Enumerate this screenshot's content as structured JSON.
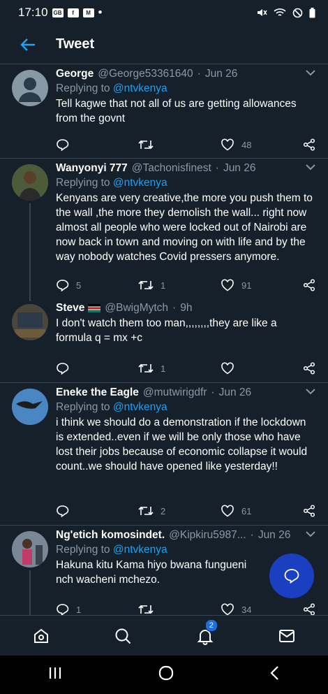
{
  "status_bar": {
    "time": "17:10",
    "notif_labels": [
      "GB",
      "f",
      "M"
    ]
  },
  "header": {
    "title": "Tweet"
  },
  "tweets": [
    {
      "name": "George",
      "handle": "@George53361640",
      "dot": "·",
      "time": "Jun 26",
      "replying_prefix": "Replying to ",
      "replying_to": "@ntvkenya",
      "text": "Tell kagwe that not all of us are getting allowances from the govnt",
      "replies": "",
      "retweets": "",
      "likes": "48"
    },
    {
      "name": "Wanyonyi 777",
      "handle": "@Tachonisfinest",
      "dot": "·",
      "time": "Jun 26",
      "replying_prefix": "Replying to ",
      "replying_to": "@ntvkenya",
      "text": "Kenyans are very creative,the more you push them to the wall ,the more they demolish the wall... right now almost all people who were locked out of Nairobi are now back in town and moving on with life and by the way nobody watches Covid pressers anymore.",
      "replies": "5",
      "retweets": "1",
      "likes": "91"
    },
    {
      "name": "Steve",
      "handle": "@BwigMytch",
      "dot": "·",
      "time": "9h",
      "text": "I don't watch them too man,,,,,,,,they are like a formula q = mx +c",
      "replies": "",
      "retweets": "1",
      "likes": ""
    },
    {
      "name": "Eneke the Eagle",
      "handle": "@mutwirigdfr",
      "dot": "·",
      "time": "Jun 26",
      "replying_prefix": "Replying to ",
      "replying_to": "@ntvkenya",
      "text": "i think we should do a demonstration if the lockdown is extended..even if we will be only those who have lost their jobs because of economic collapse it would count..we should have opened like yesterday!!",
      "replies": "",
      "retweets": "2",
      "likes": "61"
    },
    {
      "name": "Ng'etich komosindet.",
      "handle": "@Kipkiru5987...",
      "dot": "·",
      "time": "Jun 26",
      "replying_prefix": "Replying to ",
      "replying_to": "@ntvkenya",
      "text": "Hakuna kitu Kama hiyo bwana fungueni nch wacheni mchezo.",
      "replies": "1",
      "retweets": "",
      "likes": "34"
    }
  ],
  "bottom_nav": {
    "notifications_badge": "2"
  },
  "icons": [
    "back-arrow-icon",
    "chevron-down-icon",
    "reply-icon",
    "retweet-icon",
    "like-icon",
    "share-icon",
    "compose-reply-icon",
    "home-icon",
    "search-icon",
    "bell-icon",
    "mail-icon",
    "recents-icon",
    "home-circle-icon",
    "back-chevron-icon"
  ],
  "colors": {
    "background": "#15202b",
    "accent": "#1da1f2",
    "muted": "#8899a6",
    "divider": "#38444d",
    "fab": "#1a3fc0"
  }
}
